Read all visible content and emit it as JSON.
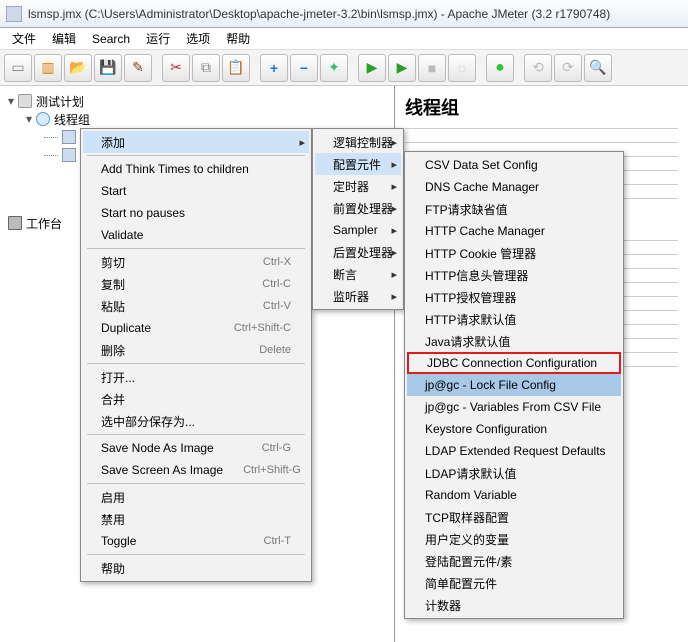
{
  "title": "lsmsp.jmx (C:\\Users\\Administrator\\Desktop\\apache-jmeter-3.2\\bin\\lsmsp.jmx) - Apache JMeter (3.2 r1790748)",
  "menubar": [
    "文件",
    "编辑",
    "Search",
    "运行",
    "选项",
    "帮助"
  ],
  "tree": {
    "root": "测试计划",
    "child": "线程组",
    "workbench": "工作台"
  },
  "rightpane": {
    "heading": "线程组"
  },
  "ctx1": {
    "items": [
      {
        "label": "添加",
        "arrow": true,
        "hov": true
      },
      {
        "sep": true
      },
      {
        "label": "Add Think Times to children"
      },
      {
        "label": "Start"
      },
      {
        "label": "Start no pauses"
      },
      {
        "label": "Validate"
      },
      {
        "sep": true
      },
      {
        "label": "剪切",
        "sc": "Ctrl-X"
      },
      {
        "label": "复制",
        "sc": "Ctrl-C"
      },
      {
        "label": "粘贴",
        "sc": "Ctrl-V"
      },
      {
        "label": "Duplicate",
        "sc": "Ctrl+Shift-C"
      },
      {
        "label": "删除",
        "sc": "Delete"
      },
      {
        "sep": true
      },
      {
        "label": "打开..."
      },
      {
        "label": "合并"
      },
      {
        "label": "选中部分保存为..."
      },
      {
        "sep": true
      },
      {
        "label": "Save Node As Image",
        "sc": "Ctrl-G"
      },
      {
        "label": "Save Screen As Image",
        "sc": "Ctrl+Shift-G"
      },
      {
        "sep": true
      },
      {
        "label": "启用"
      },
      {
        "label": "禁用"
      },
      {
        "label": "Toggle",
        "sc": "Ctrl-T"
      },
      {
        "sep": true
      },
      {
        "label": "帮助"
      }
    ]
  },
  "ctx2": {
    "items": [
      {
        "label": "逻辑控制器",
        "arrow": true
      },
      {
        "label": "配置元件",
        "arrow": true,
        "hov": true
      },
      {
        "label": "定时器",
        "arrow": true
      },
      {
        "label": "前置处理器",
        "arrow": true
      },
      {
        "label": "Sampler",
        "arrow": true
      },
      {
        "label": "后置处理器",
        "arrow": true
      },
      {
        "label": "断言",
        "arrow": true
      },
      {
        "label": "监听器",
        "arrow": true
      }
    ]
  },
  "ctx3": {
    "items": [
      {
        "label": "CSV Data Set Config"
      },
      {
        "label": "DNS Cache Manager"
      },
      {
        "label": "FTP请求缺省值"
      },
      {
        "label": "HTTP Cache Manager"
      },
      {
        "label": "HTTP Cookie 管理器"
      },
      {
        "label": "HTTP信息头管理器"
      },
      {
        "label": "HTTP授权管理器"
      },
      {
        "label": "HTTP请求默认值"
      },
      {
        "label": "Java请求默认值"
      },
      {
        "label": "JDBC Connection Configuration",
        "hl": true
      },
      {
        "label": "jp@gc - Lock File Config",
        "hov": true
      },
      {
        "label": "jp@gc - Variables From CSV File"
      },
      {
        "label": "Keystore Configuration"
      },
      {
        "label": "LDAP Extended Request Defaults"
      },
      {
        "label": "LDAP请求默认值"
      },
      {
        "label": "Random Variable"
      },
      {
        "label": "TCP取样器配置"
      },
      {
        "label": "用户定义的变量"
      },
      {
        "label": "登陆配置元件/素"
      },
      {
        "label": "简单配置元件"
      },
      {
        "label": "计数器"
      }
    ]
  },
  "toolbar_icons": [
    {
      "n": "new",
      "g": "▭",
      "c": "g-new"
    },
    {
      "n": "templates",
      "g": "▥",
      "c": "g-tpl"
    },
    {
      "n": "open",
      "g": "📂",
      "c": "g-open"
    },
    {
      "n": "save",
      "g": "💾",
      "c": "g-save"
    },
    {
      "n": "edit",
      "g": "✎",
      "c": "g-edit"
    },
    {
      "sep": true
    },
    {
      "n": "cut",
      "g": "✂",
      "c": "g-cut"
    },
    {
      "n": "copy",
      "g": "⧉",
      "c": "g-copy"
    },
    {
      "n": "paste",
      "g": "📋",
      "c": "g-paste"
    },
    {
      "sep": true
    },
    {
      "n": "expand",
      "g": "+",
      "c": "g-plus"
    },
    {
      "n": "collapse",
      "g": "−",
      "c": "g-minus"
    },
    {
      "n": "toggle",
      "g": "✦",
      "c": "g-wand"
    },
    {
      "sep": true
    },
    {
      "n": "start",
      "g": "▶",
      "c": "g-play"
    },
    {
      "n": "start-no-pause",
      "g": "▶",
      "c": "g-playn"
    },
    {
      "n": "stop",
      "g": "■",
      "c": "g-stop"
    },
    {
      "n": "shutdown",
      "g": "◌",
      "c": "g-rec"
    },
    {
      "sep": true
    },
    {
      "n": "remote-start",
      "g": "●",
      "c": "g-greendot"
    },
    {
      "sep": true
    },
    {
      "n": "clear",
      "g": "⟲",
      "c": "g-gray"
    },
    {
      "n": "clear-all",
      "g": "⟳",
      "c": "g-gray"
    },
    {
      "n": "search",
      "g": "🔍",
      "c": "g-gray"
    }
  ]
}
